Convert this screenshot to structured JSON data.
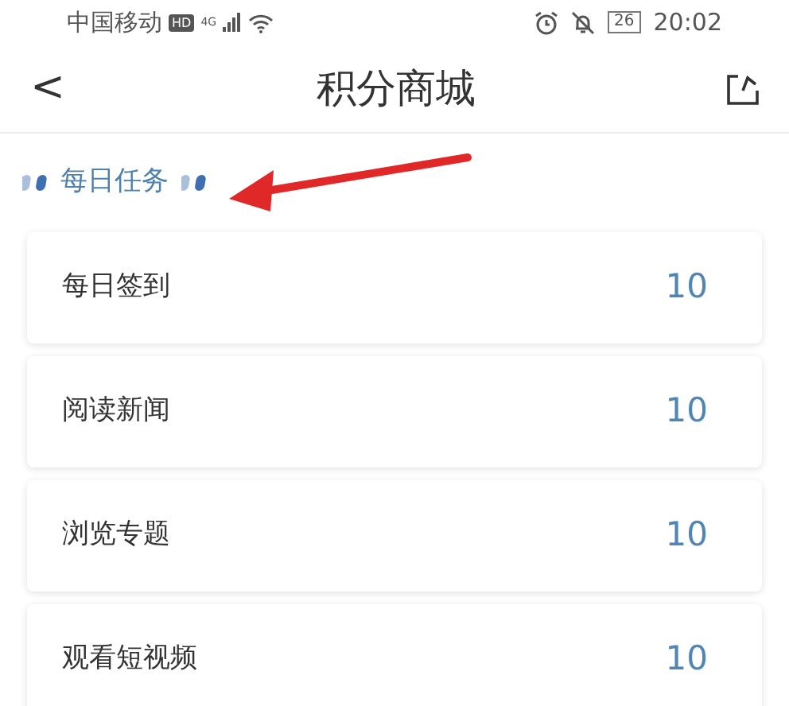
{
  "status_bar": {
    "carrier": "中国移动",
    "hd_badge": "HD",
    "network": "4G",
    "battery": "26",
    "time": "20:02"
  },
  "header": {
    "back": "<",
    "title": "积分商城"
  },
  "section": {
    "title": "每日任务"
  },
  "tasks": [
    {
      "name": "每日签到",
      "points": "10"
    },
    {
      "name": "阅读新闻",
      "points": "10"
    },
    {
      "name": "浏览专题",
      "points": "10"
    },
    {
      "name": "观看短视频",
      "points": "10"
    }
  ]
}
